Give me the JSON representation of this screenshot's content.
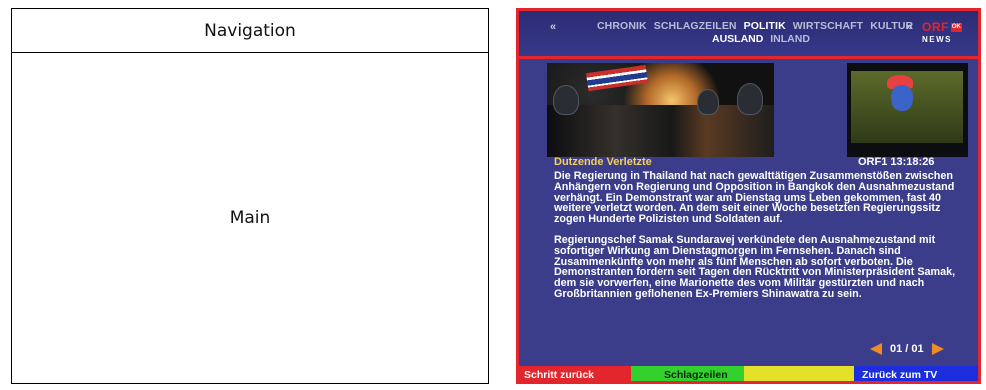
{
  "wireframe": {
    "nav_label": "Navigation",
    "main_label": "Main"
  },
  "teletext": {
    "nav": {
      "prev": "«",
      "next": "»",
      "row1": [
        "CHRONIK",
        "SCHLAGZEILEN",
        "POLITIK",
        "WIRTSCHAFT",
        "KULTUR"
      ],
      "row2": [
        "AUSLAND",
        "INLAND"
      ],
      "active_row1": "POLITIK",
      "active_row2": "AUSLAND"
    },
    "logo": {
      "brand": "ORF",
      "badge": "OK",
      "sub": "NEWS"
    },
    "article": {
      "headline": "Dutzende Verletzte",
      "timestamp": "ORF1 13:18:26",
      "paragraph1": "Die Regierung in Thailand hat nach gewalttätigen Zusammenstößen zwischen Anhängern von Regierung und Opposition in Bangkok den Ausnahmezustand verhängt. Ein Demonstrant war am Dienstag ums Leben gekommen, fast 40 weitere verletzt worden. An dem seit einer Woche besetzten Regierungssitz zogen Hunderte Polizisten und Soldaten auf.",
      "paragraph2": "Regierungschef Samak Sundaravej verkündete den Ausnahmezustand mit sofortiger Wirkung am Dienstagmorgen im Fernsehen. Danach sind Zusammenkünfte von mehr als fünf Menschen ab sofort verboten. Die Demonstranten fordern seit Tagen den Rücktritt von Ministerpräsident Samak, dem sie vorwerfen, eine Marionette des vom Militär gestürzten und nach Großbritannien geflohenen Ex-Premiers Shinawatra zu sein."
    },
    "pager": "01 / 01",
    "bottom_bar": {
      "red": "Schritt zurück",
      "green": "Schlagzeilen",
      "yellow": "",
      "blue": "Zurück zum TV"
    },
    "colors": {
      "frame": "#e3262c",
      "background": "#3b3d8a",
      "headline": "#f5d155",
      "arrows": "#f08b22"
    }
  }
}
